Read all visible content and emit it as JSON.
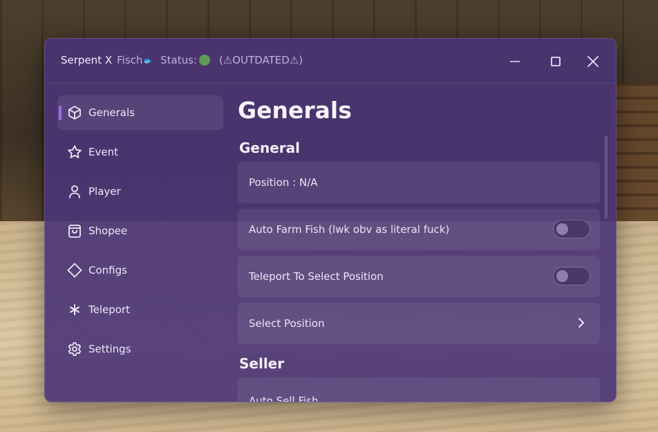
{
  "window": {
    "title": "Serpent X",
    "subtitle": "Fisch",
    "fish_glyph": "🐟",
    "status_label": "Status:",
    "status_color": "#5f9a52",
    "status_text": "(⚠OUTDATED⚠)"
  },
  "controls": {
    "minimize_icon": "minimize-icon",
    "maximize_icon": "maximize-icon",
    "close_icon": "close-icon"
  },
  "sidebar": {
    "items": [
      {
        "label": "Generals",
        "icon": "cube-icon",
        "active": true
      },
      {
        "label": "Event",
        "icon": "star-icon"
      },
      {
        "label": "Player",
        "icon": "user-icon"
      },
      {
        "label": "Shopee",
        "icon": "shopping-bag-icon"
      },
      {
        "label": "Configs",
        "icon": "diamond-icon"
      },
      {
        "label": "Teleport",
        "icon": "asterisk-icon"
      },
      {
        "label": "Settings",
        "icon": "gear-icon"
      }
    ]
  },
  "main": {
    "page_title": "Generals",
    "sections": [
      {
        "title": "General",
        "rows": [
          {
            "label": "Position : N/A",
            "type": "info"
          },
          {
            "label": "Auto Farm Fish (lwk obv as literal fuck)",
            "type": "toggle",
            "on": false
          },
          {
            "label": "Teleport To Select Position",
            "type": "toggle",
            "on": false
          },
          {
            "label": "Select Position",
            "type": "dropdown"
          }
        ]
      },
      {
        "title": "Seller",
        "rows": [
          {
            "label": "Auto Sell Fish",
            "type": "partial"
          }
        ]
      }
    ]
  },
  "colors": {
    "accent": "#9a6cf0",
    "window_bg": "#4a3476"
  }
}
